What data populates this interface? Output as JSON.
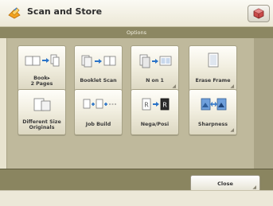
{
  "header": {
    "title": "Scan and Store",
    "app_icon": "scan-store-icon",
    "right_button_icon": "cube-icon"
  },
  "options_bar": {
    "title": "Options"
  },
  "tiles": [
    {
      "label": "Book▸\n2 Pages",
      "icon": "book-to-two-pages-icon"
    },
    {
      "label": "Booklet Scan",
      "icon": "booklet-scan-icon"
    },
    {
      "label": "N on 1",
      "icon": "n-on-1-icon"
    },
    {
      "label": "Erase Frame",
      "icon": "erase-frame-icon"
    },
    {
      "label": "Different Size\nOriginals",
      "icon": "different-size-originals-icon"
    },
    {
      "label": "Job Build",
      "icon": "job-build-icon"
    },
    {
      "label": "Nega/Posi",
      "icon": "nega-posi-icon"
    },
    {
      "label": "Sharpness",
      "icon": "sharpness-icon"
    }
  ],
  "footer": {
    "close_label": "Close"
  },
  "colors": {
    "accent": "#8c8762",
    "panel": "#bfb99c",
    "tile_face": "#f2efe1"
  }
}
